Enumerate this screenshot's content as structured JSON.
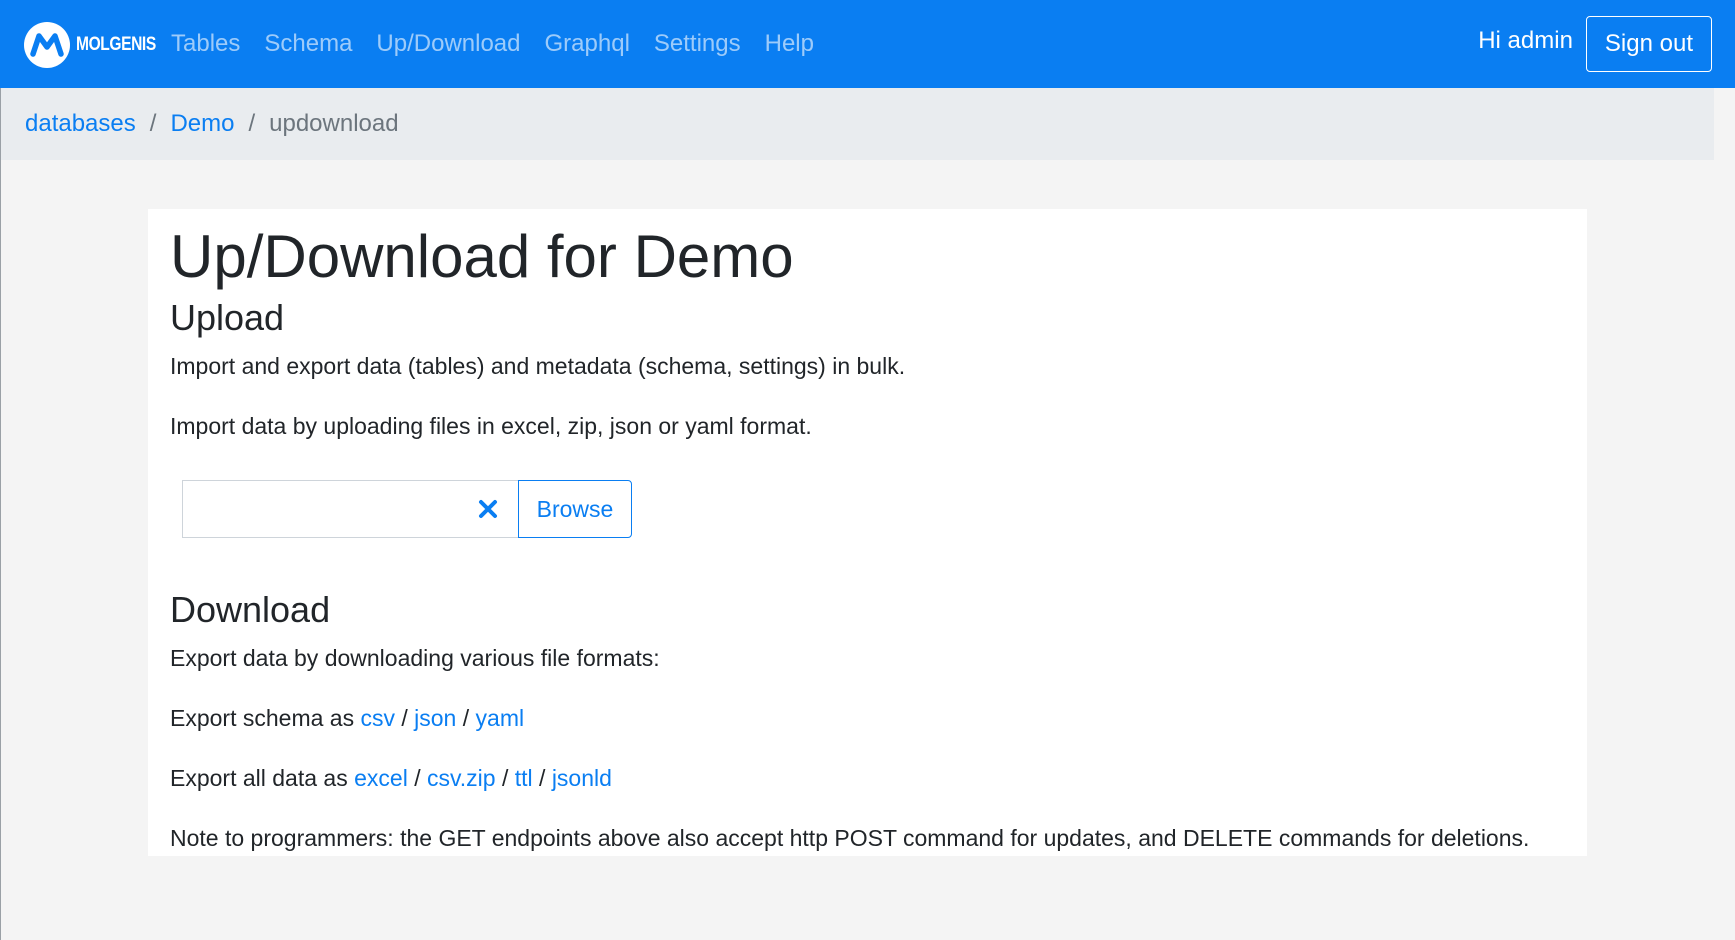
{
  "navbar": {
    "brand": "MOLGENIS",
    "links": [
      "Tables",
      "Schema",
      "Up/Download",
      "Graphql",
      "Settings",
      "Help"
    ],
    "greeting": "Hi admin",
    "signout_label": "Sign out",
    "accent_color": "#0a7ef2"
  },
  "breadcrumb": {
    "items": [
      "databases",
      "Demo"
    ],
    "current": "updownload",
    "separator": "/"
  },
  "main": {
    "title": "Up/Download for Demo",
    "upload": {
      "heading": "Upload",
      "intro": "Import and export data (tables) and metadata (schema, settings) in bulk.",
      "instructions": "Import data by uploading files in excel, zip, json or yaml format.",
      "file_value": "",
      "browse_label": "Browse"
    },
    "download": {
      "heading": "Download",
      "intro": "Export data by downloading various file formats:",
      "schema_prefix": "Export schema as",
      "schema_formats": [
        "csv",
        "json",
        "yaml"
      ],
      "data_prefix": "Export all data as",
      "data_formats": [
        "excel",
        "csv.zip",
        "ttl",
        "jsonld"
      ],
      "sep": "/",
      "note": "Note to programmers: the GET endpoints above also accept http POST command for updates, and DELETE commands for deletions."
    }
  }
}
